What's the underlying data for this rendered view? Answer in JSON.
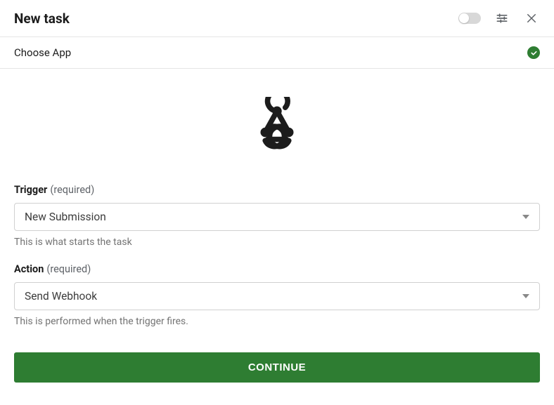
{
  "header": {
    "title": "New task"
  },
  "step": {
    "label": "Choose App"
  },
  "fields": {
    "trigger": {
      "label": "Trigger",
      "required": "(required)",
      "value": "New Submission",
      "helper": "This is what starts the task"
    },
    "action": {
      "label": "Action",
      "required": "(required)",
      "value": "Send Webhook",
      "helper": "This is performed when the trigger fires."
    }
  },
  "buttons": {
    "continue": "CONTINUE"
  }
}
